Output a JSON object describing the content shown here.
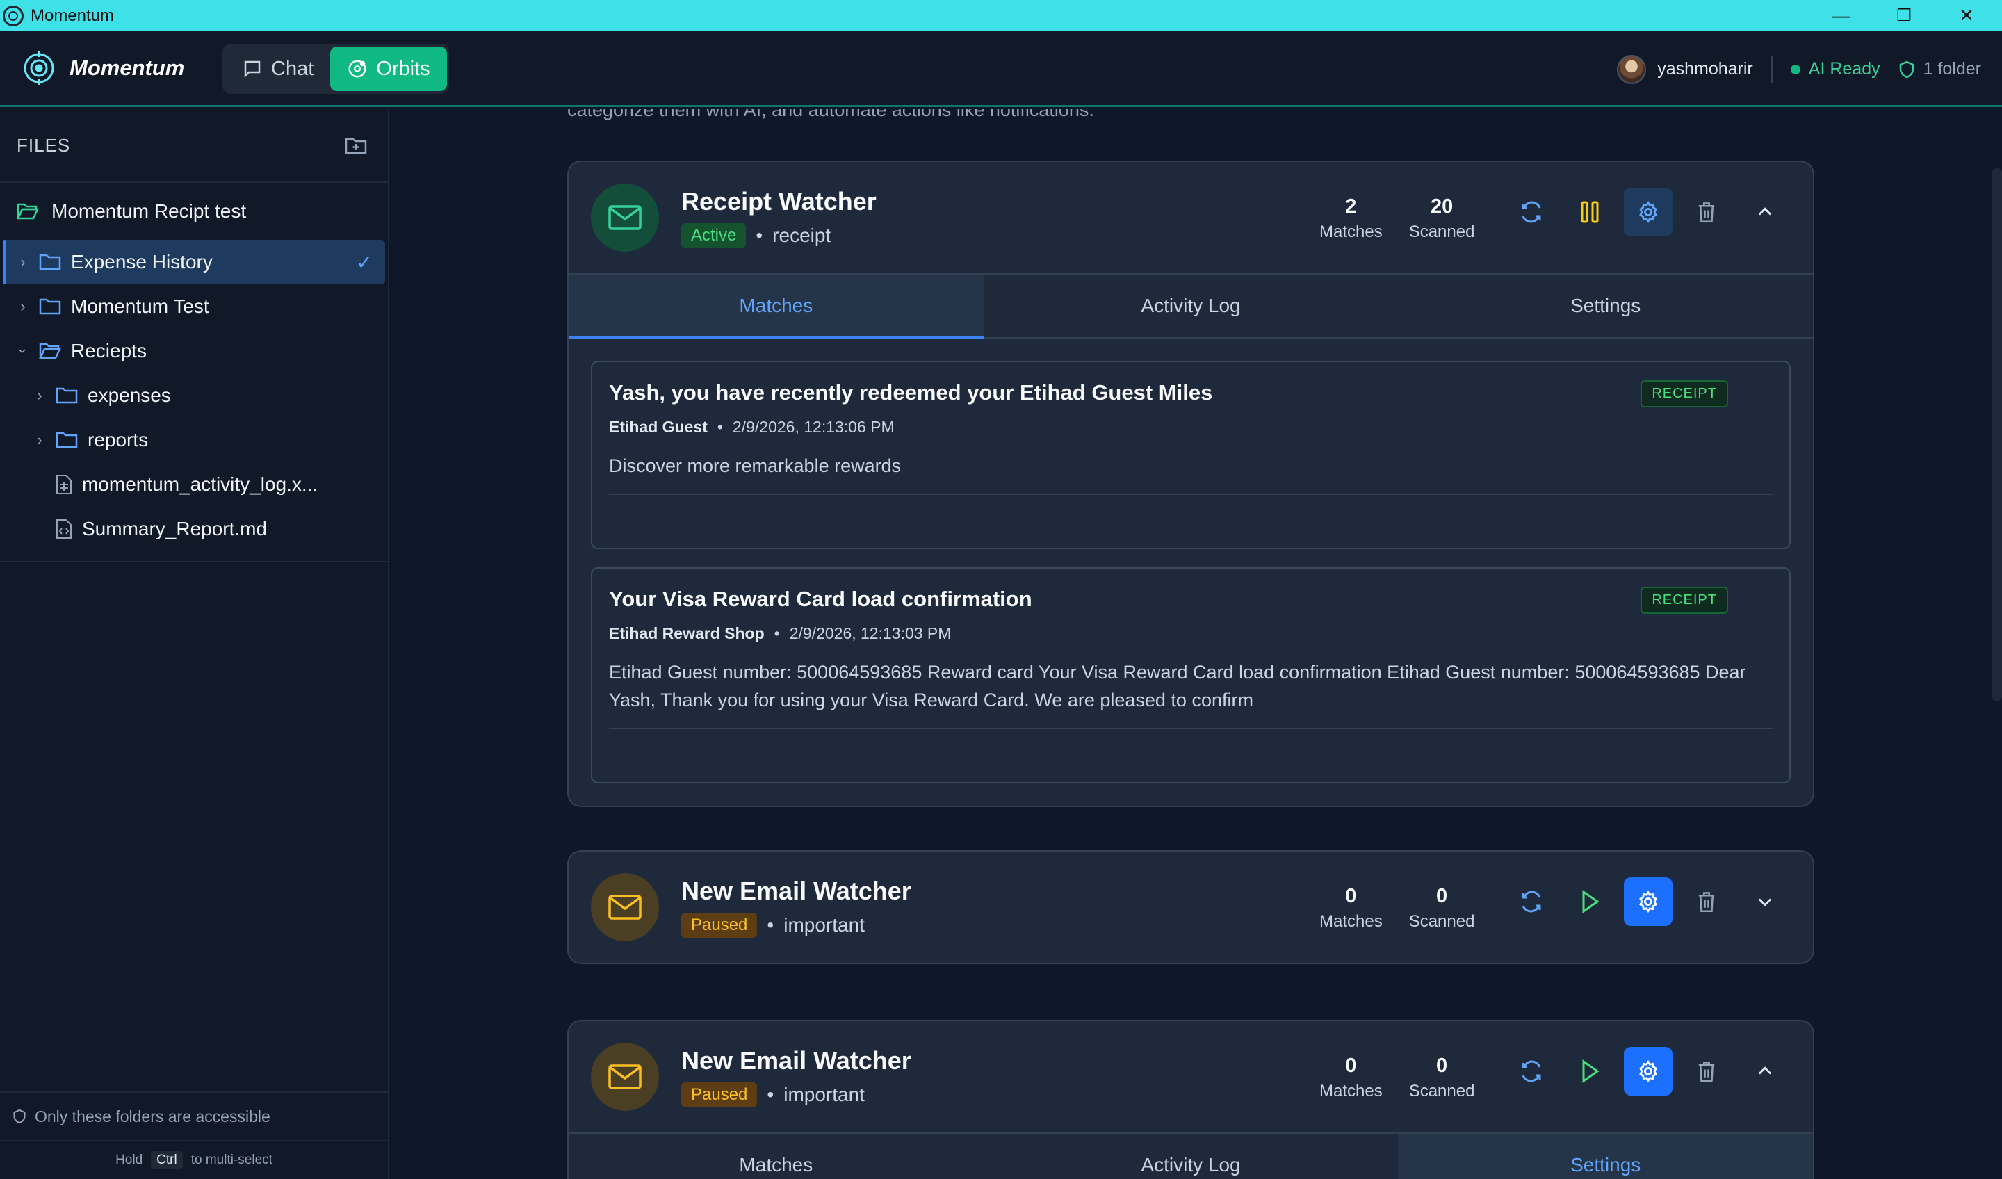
{
  "window": {
    "title": "Momentum",
    "minimize": "—",
    "restore": "❐",
    "close": "✕"
  },
  "header": {
    "brand": "Momentum",
    "nav": [
      {
        "label": "Chat",
        "active": false
      },
      {
        "label": "Orbits",
        "active": true
      }
    ],
    "username": "yashmoharir",
    "ai_status": "AI Ready",
    "folder_count": "1 folder"
  },
  "sidebar": {
    "title": "FILES",
    "root": "Momentum Recipt test",
    "items": [
      {
        "label": "Expense History",
        "type": "folder",
        "selected": true
      },
      {
        "label": "Momentum Test",
        "type": "folder"
      },
      {
        "label": "Reciepts",
        "type": "folder",
        "expanded": true
      },
      {
        "label": "expenses",
        "type": "folder"
      },
      {
        "label": "reports",
        "type": "folder"
      },
      {
        "label": "momentum_activity_log.x...",
        "type": "file"
      },
      {
        "label": "Summary_Report.md",
        "type": "file"
      }
    ],
    "access_note": "Only these folders are accessible",
    "hint_pre": "Hold",
    "hint_key": "Ctrl",
    "hint_post": "to multi-select"
  },
  "main": {
    "intro": "categorize them with AI, and automate actions like notifications.",
    "orbits": [
      {
        "name": "Receipt Watcher",
        "status": "Active",
        "keyword": "receipt",
        "matches": "2",
        "scanned": "20",
        "matches_label": "Matches",
        "scanned_label": "Scanned",
        "tabs": [
          "Matches",
          "Activity Log",
          "Settings"
        ],
        "active_tab": "Matches",
        "items": [
          {
            "title": "Yash, you have recently redeemed your Etihad Guest Miles",
            "from": "Etihad Guest",
            "date": "2/9/2026, 12:13:06 PM",
            "snippet": "Discover more remarkable rewards",
            "tag": "RECEIPT"
          },
          {
            "title": "Your Visa Reward Card load confirmation",
            "from": "Etihad Reward Shop",
            "date": "2/9/2026, 12:13:03 PM",
            "snippet": "Etihad Guest number: 500064593685 Reward card Your Visa Reward Card load confirmation Etihad Guest number: 500064593685 Dear Yash, Thank you for using your Visa Reward Card. We are pleased to confirm",
            "tag": "RECEIPT"
          }
        ]
      },
      {
        "name": "New Email Watcher",
        "status": "Paused",
        "keyword": "important",
        "matches": "0",
        "scanned": "0",
        "matches_label": "Matches",
        "scanned_label": "Scanned"
      },
      {
        "name": "New Email Watcher",
        "status": "Paused",
        "keyword": "important",
        "matches": "0",
        "scanned": "0",
        "matches_label": "Matches",
        "scanned_label": "Scanned",
        "tabs": [
          "Matches",
          "Activity Log",
          "Settings"
        ],
        "active_tab": "Settings"
      }
    ]
  },
  "colors": {
    "titlebar": "#3fe1e8",
    "accent_green": "#10b981",
    "accent_blue": "#3b82f6",
    "paused": "#fbbf24"
  }
}
